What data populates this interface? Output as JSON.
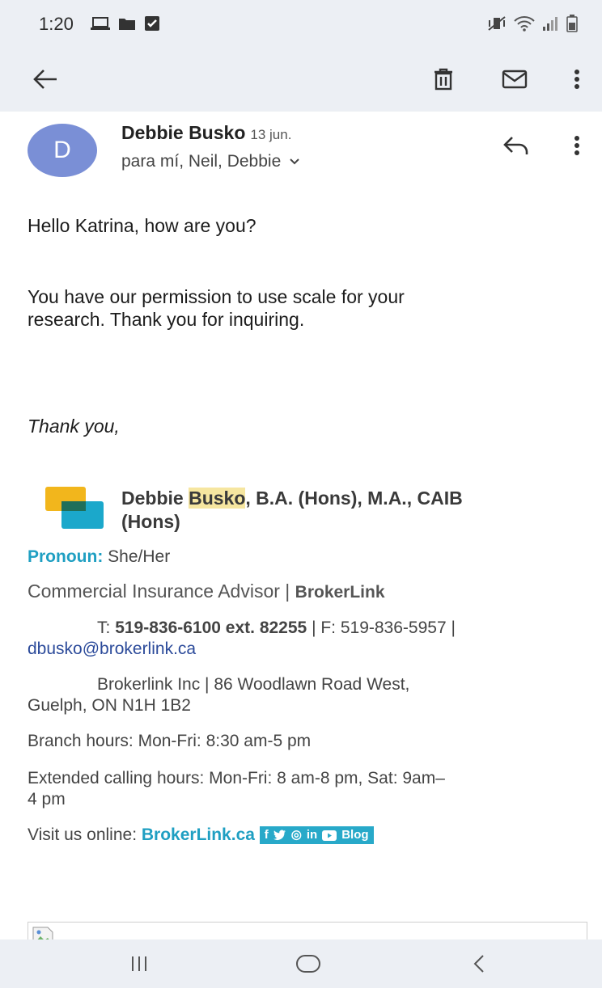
{
  "status_bar": {
    "time": "1:20",
    "left_icons": [
      "laptop-icon",
      "folder-icon",
      "checkbox-icon"
    ],
    "right_icons": [
      "mute-vibrate-icon",
      "wifi-icon",
      "signal-icon",
      "battery-icon"
    ]
  },
  "app_bar": {
    "actions": [
      "back-arrow-icon",
      "trash-icon",
      "mail-icon",
      "more-vert-icon"
    ]
  },
  "email": {
    "avatar_letter": "D",
    "sender": "Debbie Busko",
    "date": "13 jun.",
    "recipients": "para mí, Neil, Debbie",
    "greeting": "Hello Katrina, how are you?",
    "paragraph_line1": "You have our permission to use scale for your",
    "paragraph_line2": "research. Thank you for inquiring.",
    "closing": "Thank you,"
  },
  "signature": {
    "name_part1": "Debbie ",
    "name_highlight": "Busko",
    "name_part2": ", B.A. (Hons), M.A., CAIB",
    "name_line2": "(Hons)",
    "pronoun_label": "Pronoun:",
    "pronoun_value": "She/Her",
    "title": "Commercial Insurance Advisor |",
    "company": "BrokerLink",
    "phone_label": "T:",
    "phone": "519-836-6100 ext. 82255",
    "fax": "| F: 519-836-5957 |",
    "email": "dbusko@brokerlink.ca",
    "address_line1": "Brokerlink Inc | 86 Woodlawn Road West,",
    "address_line2": "Guelph, ON N1H 1B2",
    "branch_hours": "Branch hours: Mon-Fri: 8:30 am-5 pm",
    "extended_hours_line1": "Extended calling hours: Mon-Fri: 8 am-8 pm, Sat: 9am–",
    "extended_hours_line2": "4 pm",
    "visit_label": "Visit us online:",
    "website": "BrokerLink.ca",
    "social": {
      "facebook": "f",
      "instagram": "◎",
      "linkedin": "in",
      "blog": "Blog"
    },
    "colors": {
      "teal": "#1f9fc2",
      "highlight": "#f6e6a0",
      "logo_yellow": "#f2b61c",
      "logo_teal": "#1ba8cb"
    }
  },
  "nav_bar": {
    "buttons": [
      "recents-icon",
      "home-icon",
      "back-icon"
    ]
  }
}
